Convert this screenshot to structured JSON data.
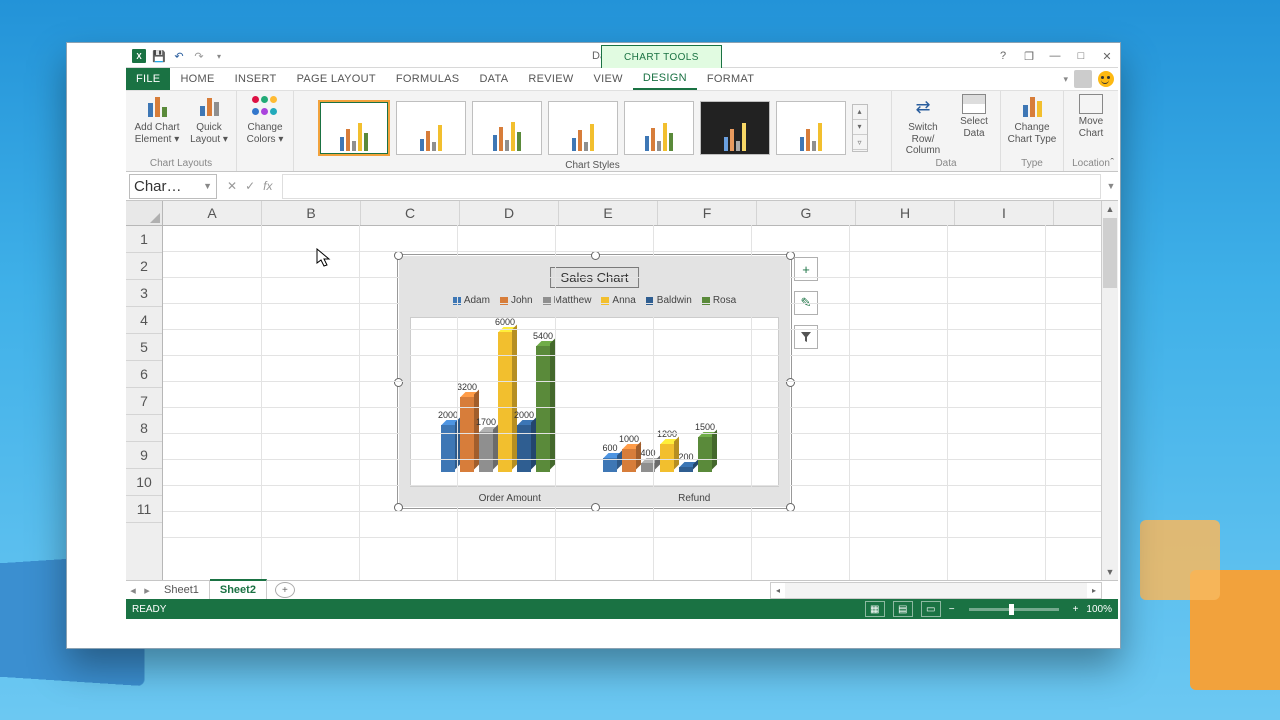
{
  "titlebar": {
    "doc_title": "Data - Excel",
    "context_tab": "CHART TOOLS"
  },
  "window_controls": {
    "help": "?",
    "restore_down": "❐",
    "minimize": "—",
    "maximize": "□",
    "close": "✕"
  },
  "tabs": {
    "file": "FILE",
    "home": "HOME",
    "insert": "INSERT",
    "page_layout": "PAGE LAYOUT",
    "formulas": "FORMULAS",
    "data": "DATA",
    "review": "REVIEW",
    "view": "VIEW",
    "design": "DESIGN",
    "format": "FORMAT"
  },
  "ribbon": {
    "chart_layouts_label": "Chart Layouts",
    "add_chart_element": "Add Chart Element ▾",
    "quick_layout": "Quick Layout ▾",
    "change_colors": "Change Colors ▾",
    "chart_styles_label": "Chart Styles",
    "data_label": "Data",
    "switch_row": "Switch Row/\nColumn",
    "select_data": "Select Data",
    "type_label": "Type",
    "change_chart_type": "Change Chart Type",
    "location_label": "Location",
    "move_chart": "Move Chart"
  },
  "name_box": "Char…",
  "columns": [
    "A",
    "B",
    "C",
    "D",
    "E",
    "F",
    "G",
    "H",
    "I"
  ],
  "rows": [
    "1",
    "2",
    "3",
    "4",
    "5",
    "6",
    "7",
    "8",
    "9",
    "10",
    "11"
  ],
  "chart": {
    "title": "Sales Chart",
    "legend": [
      {
        "name": "Adam",
        "color": "#3e77b5"
      },
      {
        "name": "John",
        "color": "#d77d3a"
      },
      {
        "name": "Matthew",
        "color": "#8f8f8f"
      },
      {
        "name": "Anna",
        "color": "#f2bf2e"
      },
      {
        "name": "Baldwin",
        "color": "#2f5e91"
      },
      {
        "name": "Rosa",
        "color": "#5a8a3a"
      }
    ],
    "categories": [
      "Order Amount",
      "Refund"
    ]
  },
  "chart_data": {
    "type": "bar",
    "title": "Sales Chart",
    "categories": [
      "Order Amount",
      "Refund"
    ],
    "series": [
      {
        "name": "Adam",
        "color": "#3e77b5",
        "values": [
          2000,
          600
        ]
      },
      {
        "name": "John",
        "color": "#d77d3a",
        "values": [
          3200,
          1000
        ]
      },
      {
        "name": "Matthew",
        "color": "#8f8f8f",
        "values": [
          1700,
          400
        ]
      },
      {
        "name": "Anna",
        "color": "#f2bf2e",
        "values": [
          6000,
          1200
        ]
      },
      {
        "name": "Baldwin",
        "color": "#2f5e91",
        "values": [
          2000,
          200
        ]
      },
      {
        "name": "Rosa",
        "color": "#5a8a3a",
        "values": [
          5400,
          1500
        ]
      }
    ],
    "ylim": [
      0,
      6000
    ],
    "xlabel": "",
    "ylabel": ""
  },
  "side_buttons": {
    "plus": "+",
    "brush": "✎",
    "filter": "▼"
  },
  "sheets": {
    "sheet1": "Sheet1",
    "sheet2": "Sheet2"
  },
  "status": {
    "ready": "READY",
    "zoom": "100%",
    "minus": "−",
    "plus": "+"
  }
}
